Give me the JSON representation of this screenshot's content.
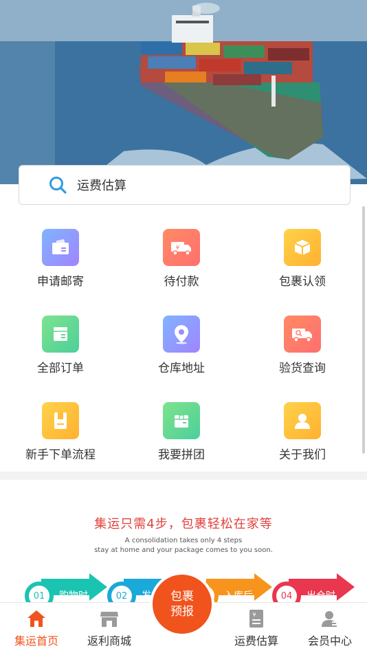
{
  "search": {
    "placeholder": "运费估算"
  },
  "menu": [
    {
      "label": "申请邮寄",
      "icon": "wallet-icon"
    },
    {
      "label": "待付款",
      "icon": "truck-payment-icon"
    },
    {
      "label": "包裹认领",
      "icon": "box-icon"
    },
    {
      "label": "全部订单",
      "icon": "orders-icon"
    },
    {
      "label": "仓库地址",
      "icon": "location-pin-icon"
    },
    {
      "label": "验货查询",
      "icon": "truck-search-icon"
    },
    {
      "label": "新手下单流程",
      "icon": "document-icon"
    },
    {
      "label": "我要拼团",
      "icon": "package-group-icon"
    },
    {
      "label": "关于我们",
      "icon": "user-icon"
    }
  ],
  "promo": {
    "title": "集运只需4步，包裹轻松在家等",
    "subtitle_line1": "A consolidation takes only 4 steps",
    "subtitle_line2": "stay at home and your package comes to you soon.",
    "steps": [
      {
        "num": "01",
        "label": "购物时",
        "color": "#1bc3b1"
      },
      {
        "num": "02",
        "label": "发货",
        "color": "#1aa9d8"
      },
      {
        "num": "03",
        "label": "入库后",
        "color": "#f7941d"
      },
      {
        "num": "04",
        "label": "出仓时",
        "color": "#e8374f"
      }
    ]
  },
  "tabbar": {
    "items": [
      {
        "label": "集运首页",
        "icon": "home-icon",
        "active": true
      },
      {
        "label": "返利商城",
        "icon": "store-icon"
      },
      {
        "label": "运费估算",
        "icon": "calculator-icon"
      },
      {
        "label": "会员中心",
        "icon": "member-icon"
      }
    ],
    "center": {
      "line1": "包裹",
      "line2": "预报"
    }
  },
  "colors": {
    "accent": "#f0531c",
    "promo_title": "#e0413b"
  }
}
